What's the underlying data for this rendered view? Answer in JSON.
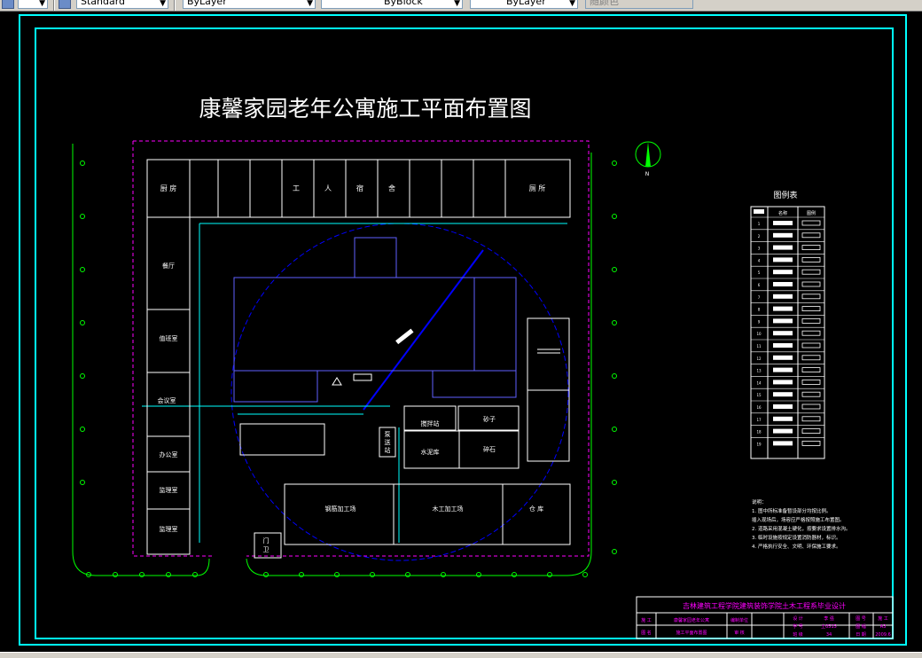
{
  "toolbar": {
    "text_style": "Standard",
    "layer": "ByLayer",
    "linetype": "ByBlock",
    "lineweight": "ByLayer",
    "plot_style": "随颜色"
  },
  "drawing": {
    "title": "康馨家园老年公寓施工平面布置图",
    "north": "N",
    "rooms": {
      "kitchen_left": "厨 房",
      "worker_1": "工",
      "worker_2": "人",
      "worker_3": "宿",
      "worker_4": "舍",
      "toilet": "厕 所",
      "dining": "餐厅",
      "duty": "值班室",
      "meeting": "会议室",
      "office_1": "办公室",
      "office_2": "监理室",
      "office_3": "监理室",
      "gate_1": "门",
      "gate_2": "卫",
      "mixer": "搅拌站",
      "sand": "砂子",
      "cement": "水泥库",
      "stone": "碎石",
      "pump_1": "泵",
      "pump_2": "送",
      "pump_3": "站",
      "rebar": "钢筋加工场",
      "carpentry": "木工加工场",
      "warehouse": "仓 库"
    },
    "legend_title": "图例表",
    "legend_header": [
      "名称",
      "图例"
    ],
    "legend_rows": [
      "1",
      "2",
      "3",
      "4",
      "5",
      "6",
      "7",
      "8",
      "9",
      "10",
      "11",
      "12",
      "13",
      "14",
      "15",
      "16",
      "17",
      "18",
      "19"
    ],
    "notes": [
      "说明：",
      "1. 图中所标准备暂设部分均按比例。",
      "   插入现场后，场容应严格按照施工布置图。",
      "2. 道路采用混凝土硬化，按要求设置排水沟。",
      "3. 临时设施按规定设置消防器材，标识。",
      "4. 严格执行安全、文明、环保施工要求。"
    ],
    "titleblock": {
      "school": "吉林建筑工程学院建筑装饰学院土木工程系毕业设计",
      "row1": [
        "施 工",
        "康馨家园老年公寓",
        "编制单位",
        "设 计",
        "李 强",
        "图 号",
        "施 工"
      ],
      "row2": [
        "图 名",
        "",
        "施工平面布置图",
        "审 核",
        "",
        "图 幅",
        "A3"
      ],
      "row3": [
        "",
        "",
        "",
        "学 号",
        "土0515",
        "日 期",
        "2009.6"
      ],
      "row4": [
        "",
        "",
        "",
        "班 级",
        "34",
        "比 例",
        "1:100"
      ]
    }
  }
}
